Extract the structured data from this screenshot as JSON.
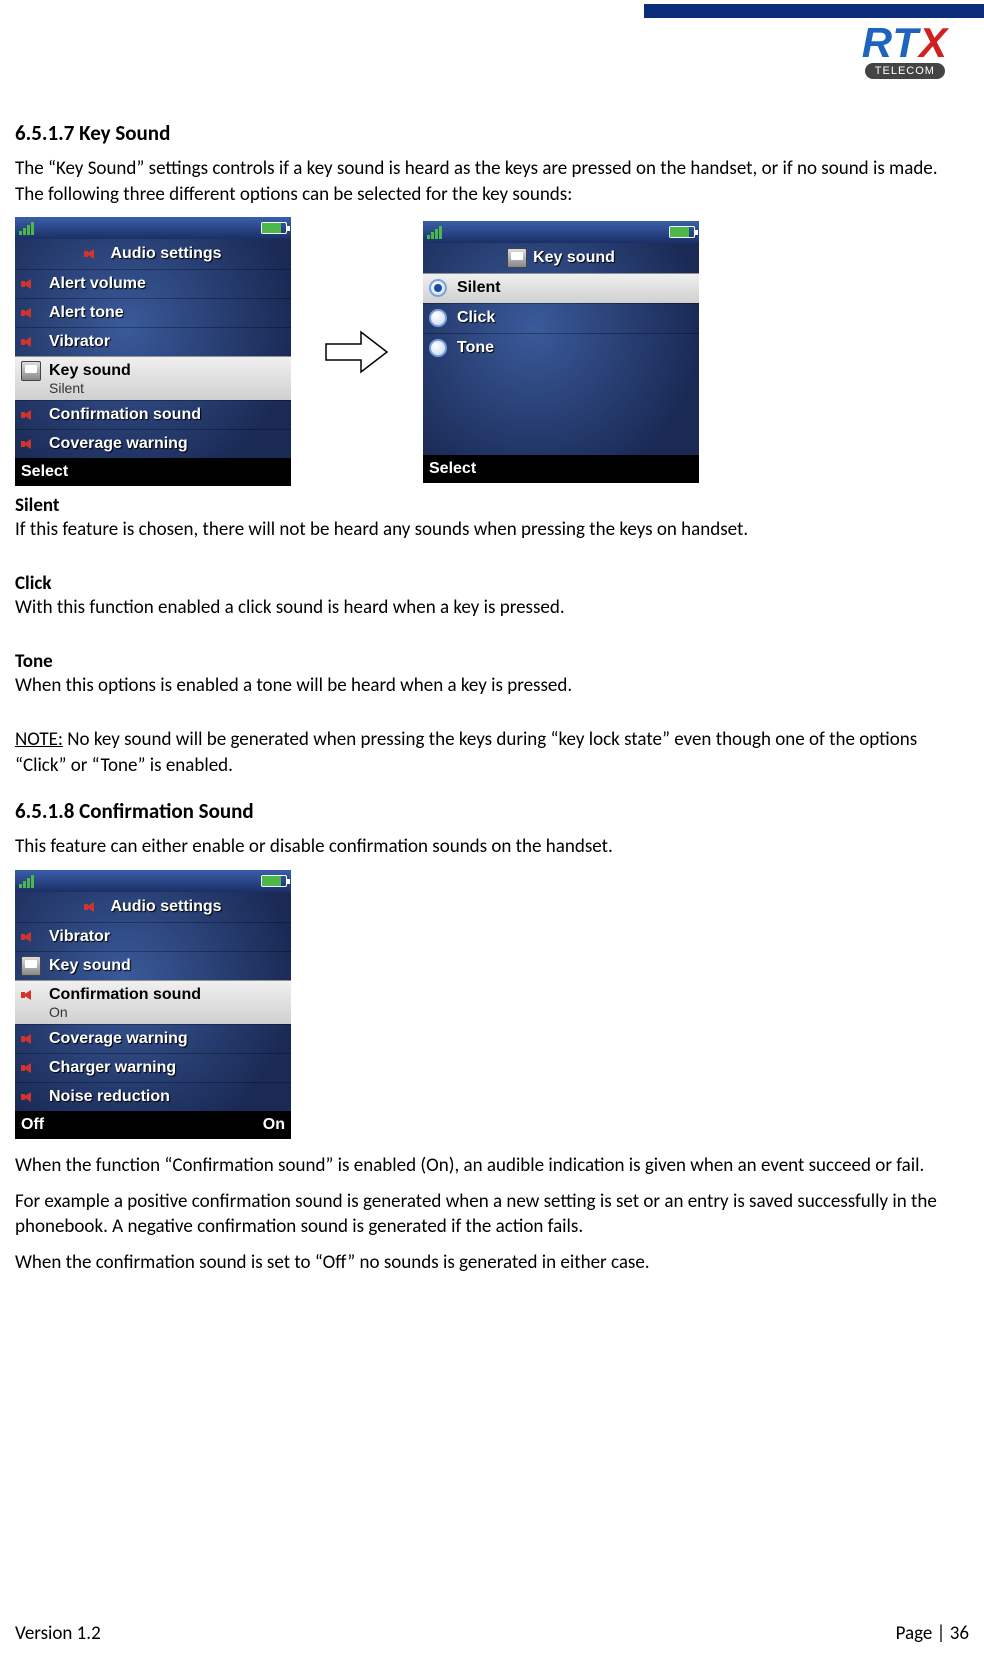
{
  "logo": {
    "main": "RT",
    "x": "X",
    "sub": "TELECOM"
  },
  "s1": {
    "heading": "6.5.1.7 Key Sound",
    "intro": "The “Key Sound” settings controls if a key sound is heard as the keys are pressed on the handset, or if no sound is made. The following three different options can be selected for the key sounds:",
    "screen1": {
      "title": "Audio settings",
      "items": {
        "0": {
          "label": "Alert volume"
        },
        "1": {
          "label": "Alert tone"
        },
        "2": {
          "label": "Vibrator"
        },
        "3": {
          "label": "Key sound",
          "sub": "Silent"
        },
        "4": {
          "label": "Confirmation sound"
        },
        "5": {
          "label": "Coverage warning"
        }
      },
      "softkey_left": "Select"
    },
    "screen2": {
      "title": "Key sound",
      "options": {
        "0": {
          "label": "Silent"
        },
        "1": {
          "label": "Click"
        },
        "2": {
          "label": "Tone"
        }
      },
      "softkey_left": "Select"
    },
    "opt_silent_h": "Silent",
    "opt_silent_t": "If this feature is chosen, there will not be heard any sounds when pressing the keys on handset.",
    "opt_click_h": "Click",
    "opt_click_t": "With this function enabled a click sound is heard when a key is pressed.",
    "opt_tone_h": "Tone",
    "opt_tone_t": "When this options is enabled a tone will be heard when a key is pressed.",
    "note_label": "NOTE:",
    "note_text": " No key sound will be generated when pressing the keys during “key lock state” even though one of the options “Click” or “Tone” is enabled."
  },
  "s2": {
    "heading": "6.5.1.8 Confirmation Sound",
    "intro": "This feature can either enable or disable confirmation sounds on the handset.",
    "screen": {
      "title": "Audio settings",
      "items": {
        "0": {
          "label": "Vibrator"
        },
        "1": {
          "label": "Key sound"
        },
        "2": {
          "label": "Confirmation sound",
          "sub": "On"
        },
        "3": {
          "label": "Coverage warning"
        },
        "4": {
          "label": "Charger warning"
        },
        "5": {
          "label": "Noise reduction"
        }
      },
      "softkey_left": "Off",
      "softkey_right": "On"
    },
    "p1": "When the function “Confirmation sound” is enabled (On), an audible indication is given when an event succeed or fail.",
    "p2": "For example a positive confirmation sound is generated when a new setting is set or an entry is saved successfully in the phonebook. A negative confirmation sound is generated if the action fails.",
    "p3": "When the confirmation sound is set to “Off” no sounds is generated in either case."
  },
  "footer": {
    "version": "Version 1.2",
    "page": "Page | 36"
  }
}
